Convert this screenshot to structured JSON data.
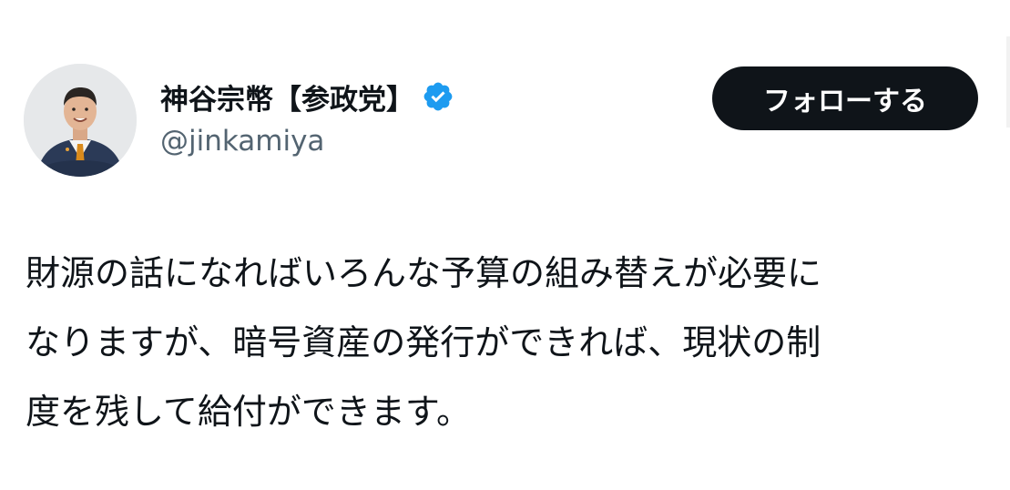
{
  "author": {
    "display_name": "神谷宗幣【参政党】",
    "handle": "@jinkamiya",
    "verified": true,
    "verified_icon": "verified-badge-icon",
    "verified_color": "#1d9bf0",
    "avatar_icon": "profile-photo"
  },
  "actions": {
    "follow_label": "フォローする",
    "follow_bg": "#0f1419",
    "follow_fg": "#ffffff"
  },
  "tweet": {
    "lines": [
      "財源の話になればいろんな予算の組み替えが必要に",
      "なりますが、暗号資産の発行ができれば、現状の制",
      "度を残して給付ができます。"
    ]
  }
}
